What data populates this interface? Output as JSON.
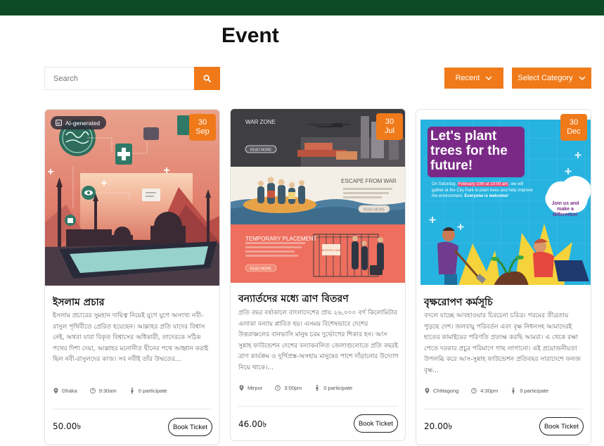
{
  "page": {
    "title": "Event"
  },
  "search": {
    "placeholder": "Search"
  },
  "filters": {
    "sort_label": "Recent",
    "category_label": "Select Category"
  },
  "cards": [
    {
      "day": "30",
      "month": "Sep",
      "ai_badge": "AI-generated",
      "title": "ইসলাম প্রচার",
      "description": "ইসলাম প্রচারের সুমহান দায়িত্ব নিয়েই যুগে যুগে অসংখ্য নবী-রাসুল পৃথিবীতে প্রেরিত হয়েছেন। আল্লাহর প্রতি যাদের বিশ্বাস নেই, অথবা যারা বিকৃত বিশ্বাসের অধিকারী, তাদেরকে সঠিক পথের দিশা দেয়া, আল্লাহর মনোনীত দ্বীনের পথে আহ্বান করাই ছিল নবী-রাসুলদের কাজ। সব নবীই তাঁর উম্মতের...",
      "location": "Dhaka",
      "time": "9:30am",
      "participants": "0 participate",
      "price": "50.00৳",
      "button": "Book Ticket"
    },
    {
      "day": "30",
      "month": "Jul",
      "title": "বন্যার্তদের মধ্যে ত্রাণ বিতরণ",
      "description": "প্রতি বছর বর্ষাকালে বাংলাদেশের প্রায় ২৬,০০০ বর্গ কিলোমিটার এলাকা বন্যায় প্লাবিত হয়। এসময় বিশেষভাবে দেশের উত্তরাঞ্চলের বানভাসি মানুষ চরম দুর্ভোগের শিকার হন। আস সুন্নাহ ফাউন্ডেশন দেশের বন্যাকবলিত জেলাগুলোতে প্রতি বছরই ত্রাণ কার্যক্রম ও দুর্গিপ্রস্ত-অসহায় মানুষের পাশে দাঁড়ানোর উদ্যোগ নিয়ে থাকে।...",
      "location": "Mirpur",
      "time": "3:00pm",
      "participants": "0 participate",
      "price": "46.00৳",
      "button": "Book Ticket",
      "panels": [
        {
          "title": "WAR ZONE",
          "button": "READ MORE"
        },
        {
          "title": "ESCAPE FROM WAR",
          "button": "READ MORE"
        },
        {
          "title": "TEMPORARY PLACEMENT",
          "button": "READ MORE",
          "sign": "REFUGEE CAMP"
        }
      ]
    },
    {
      "day": "30",
      "month": "Dec",
      "title": "বৃক্ষরোপণ কর্মসূচি",
      "description": "বদলে যাচ্ছে আবহাওয়ার চিরচেনা চরিত্র। গরমের তীব্রতায় পুড়ছে দেশ। জলবায়ু পরিবর্তন এবং বৃক্ষ নিধনসহ আমাদেরই হাতের কামাইয়ের পরিণতি প্রত্যক্ষ করছি আমরা। এ থেকে রক্ষা পেতে দরকার প্রচুর পরিমাণে গাছ লাগানো। এই প্রয়োজনীয়তা উপলব্ধি করে আস-সুন্নাহ ফাউন্ডেশন প্রতিবছর সারাদেশে ফলজ বৃক্ষ...",
      "location": "Chittagong",
      "time": "4:30pm",
      "participants": "0 participate",
      "price": "20.00৳",
      "button": "Book Ticket",
      "poster": {
        "headline": "Let's plant trees for the future!",
        "body_pre": "On Saturday, ",
        "body_highlight": "February 10th at 10:00 am",
        "body_post": ", we will gather at the City Park to plant trees and help improve the environment.",
        "body_bold": "Everyone is welcome!",
        "bubble": "Join us and make a difference!"
      }
    }
  ],
  "colors": {
    "accent": "#f07a1a",
    "topbar": "#0d4a25"
  }
}
